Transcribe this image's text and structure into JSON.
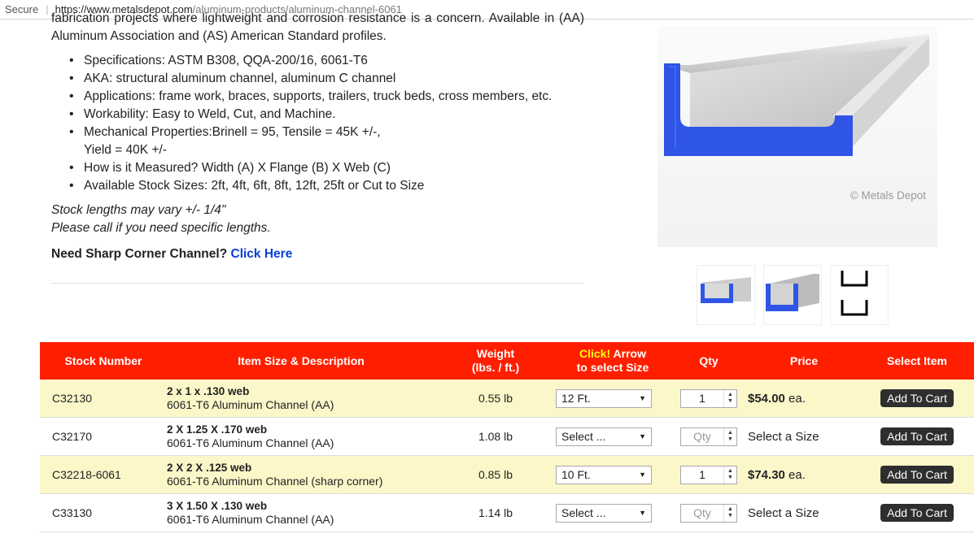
{
  "browser": {
    "secure_label": "Secure",
    "url_host": "https://www.metalsdepot.com",
    "url_path": "/aluminum-products/aluminum-channel-6061"
  },
  "content": {
    "intro": "fabrication projects where lightweight and corrosion resistance is a concern. Available in (AA) Aluminum Association and (AS) American Standard profiles.",
    "specs": [
      "Specifications: ASTM B308, QQA-200/16, 6061-T6",
      "AKA: structural aluminum channel, aluminum C channel",
      "Applications: frame work, braces, supports, trailers, truck beds, cross members, etc.",
      "Workability: Easy to Weld, Cut, and Machine.",
      "Mechanical Properties:Brinell = 95, Tensile = 45K +/-,",
      "How is it Measured? Width (A) X Flange (B) X Web (C)",
      "Available Stock Sizes: 2ft, 4ft, 6ft, 8ft, 12ft, 25ft or Cut to Size"
    ],
    "spec_yield": "Yield = 40K +/-",
    "note_line1": "Stock lengths may vary +/- 1/4\"",
    "note_line2": "Please call if you need specific lengths.",
    "sharp_label": "Need Sharp Corner Channel?",
    "sharp_link": "Click Here"
  },
  "image": {
    "watermark": "© Metals Depot"
  },
  "table": {
    "headers": {
      "stock": "Stock Number",
      "item": "Item Size & Description",
      "weight_line1": "Weight",
      "weight_line2": "(lbs. / ft.)",
      "click_word": "Click!",
      "arrow_word": " Arrow",
      "select_size": "to select Size",
      "qty": "Qty",
      "price": "Price",
      "select_item": "Select Item"
    },
    "rows": [
      {
        "stock": "C32130",
        "title": "2 x 1 x .130 web",
        "desc": "6061-T6 Aluminum Channel (AA)",
        "weight": "0.55 lb",
        "size": "12 Ft.",
        "qty": "1",
        "price": "$54.00",
        "unit": " ea.",
        "button": "Add To Cart"
      },
      {
        "stock": "C32170",
        "title": "2 X 1.25 X .170 web",
        "desc": "6061-T6 Aluminum Channel (AA)",
        "weight": "1.08 lb",
        "size": "Select ...",
        "qty": "Qty",
        "price": "Select a Size",
        "button": "Add To Cart"
      },
      {
        "stock": "C32218-6061",
        "title": "2 X 2 X .125 web",
        "desc": "6061-T6 Aluminum Channel (sharp corner)",
        "weight": "0.85 lb",
        "size": "10 Ft.",
        "qty": "1",
        "price": "$74.30",
        "unit": " ea.",
        "button": "Add To Cart"
      },
      {
        "stock": "C33130",
        "title": "3 X 1.50 X .130 web",
        "desc": "6061-T6 Aluminum Channel (AA)",
        "weight": "1.14 lb",
        "size": "Select ...",
        "qty": "Qty",
        "price": "Select a Size",
        "button": "Add To Cart"
      }
    ]
  },
  "colors": {
    "header_red": "#ff1f00",
    "row_yellow": "#fbf7c9",
    "channel_blue": "#2f55e6",
    "link_blue": "#0a3fd6"
  }
}
